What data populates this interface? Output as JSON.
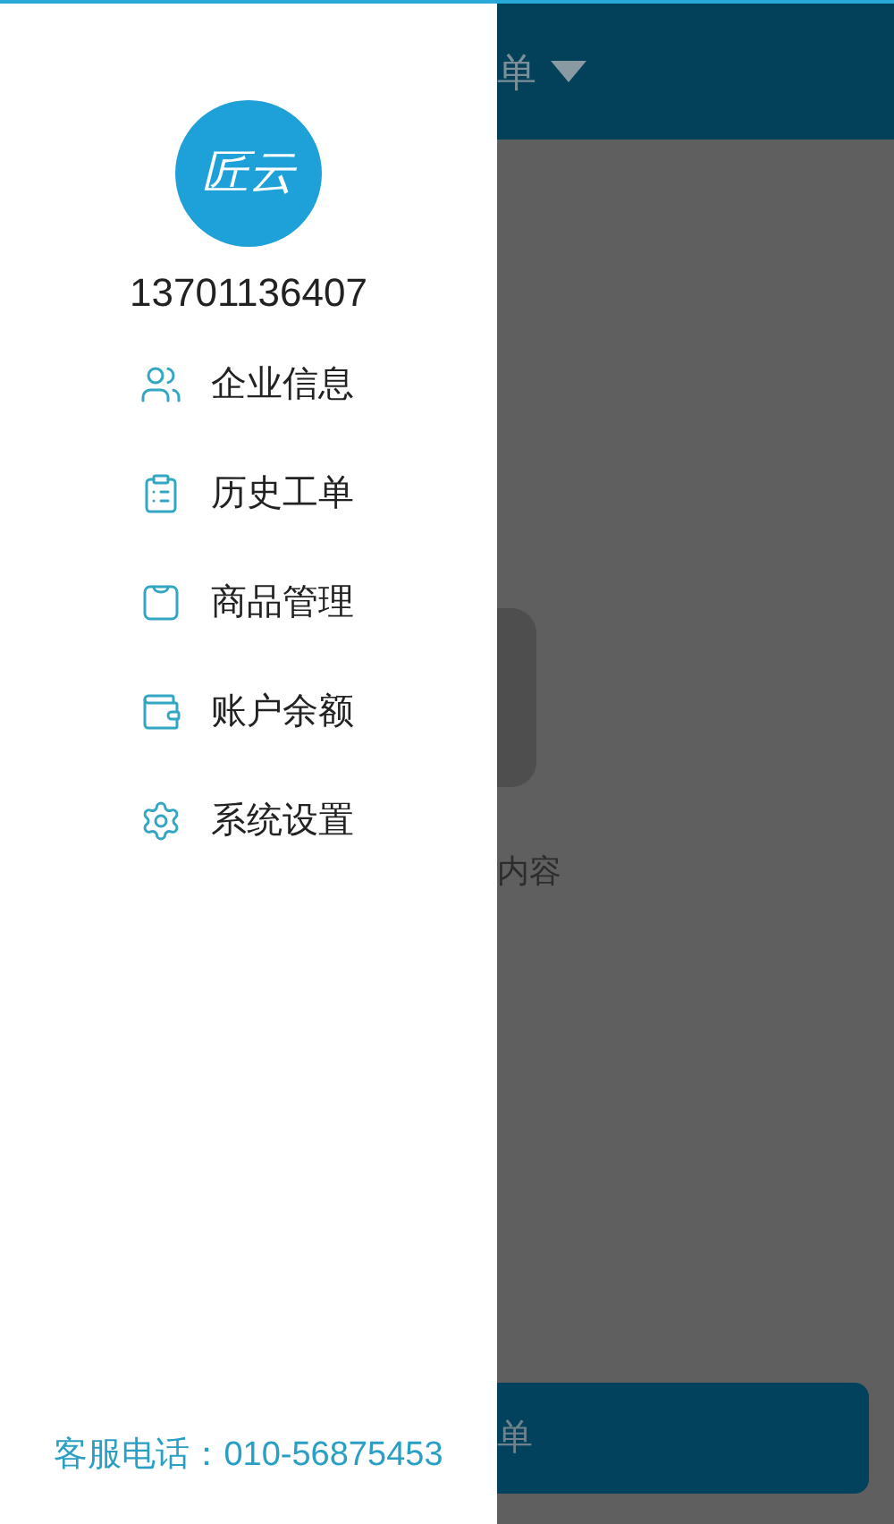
{
  "drawer": {
    "logo_text": "匠云",
    "phone": "13701136407",
    "menu": [
      {
        "label": "企业信息"
      },
      {
        "label": "历史工单"
      },
      {
        "label": "商品管理"
      },
      {
        "label": "账户余额"
      },
      {
        "label": "系统设置"
      }
    ],
    "service_phone": "客服电话：010-56875453"
  },
  "page": {
    "header_title": "单",
    "empty_text": "内容",
    "bottom_button": "单"
  }
}
